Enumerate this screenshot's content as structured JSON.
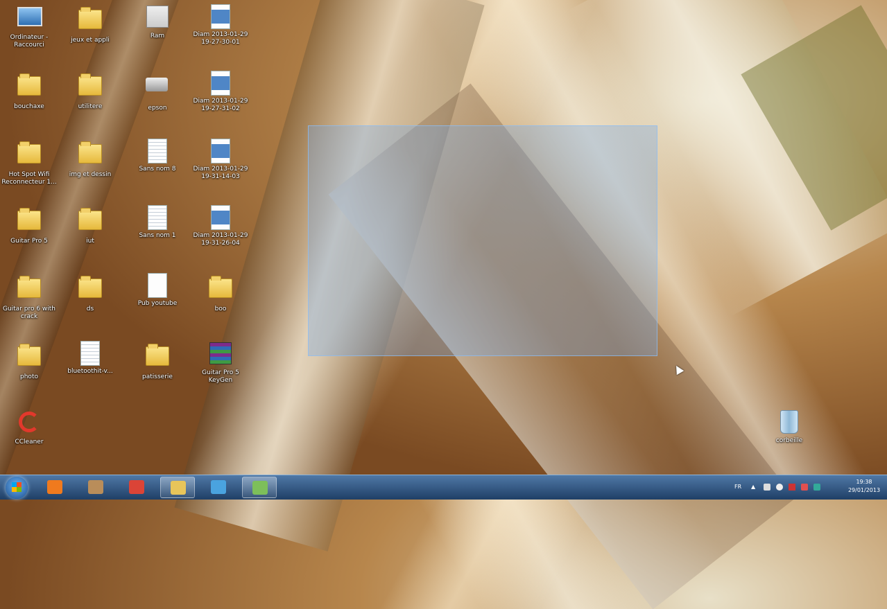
{
  "desktop_icons": [
    {
      "label": "Ordinateur - Raccourci",
      "type": "computer"
    },
    {
      "label": "jeux et appli",
      "type": "folder"
    },
    {
      "label": "Ram",
      "type": "app"
    },
    {
      "label": "Diam 2013-01-29 19-27-30-01",
      "type": "image"
    },
    {
      "label": "bouchaxe",
      "type": "folder"
    },
    {
      "label": "utilitere",
      "type": "folder"
    },
    {
      "label": "epson",
      "type": "printer"
    },
    {
      "label": "Diam 2013-01-29 19-27-31-02",
      "type": "image"
    },
    {
      "label": "Hot Spot Wifi Reconnecteur 1...",
      "type": "folder"
    },
    {
      "label": "img et dessin",
      "type": "folder"
    },
    {
      "label": "Sans nom 8",
      "type": "doc"
    },
    {
      "label": "Diam 2013-01-29 19-31-14-03",
      "type": "image"
    },
    {
      "label": "Guitar Pro 5",
      "type": "folder"
    },
    {
      "label": "iut",
      "type": "folder"
    },
    {
      "label": "Sans nom 1",
      "type": "doc"
    },
    {
      "label": "Diam 2013-01-29 19-31-26-04",
      "type": "image"
    },
    {
      "label": "Guitar pro 6 with crack",
      "type": "folder"
    },
    {
      "label": "ds",
      "type": "folder"
    },
    {
      "label": "Pub youtube",
      "type": "blank"
    },
    {
      "label": "boo",
      "type": "folder"
    },
    {
      "label": "photo",
      "type": "folder"
    },
    {
      "label": "bluetoothit-v...",
      "type": "doc"
    },
    {
      "label": "patisserie",
      "type": "folder"
    },
    {
      "label": "Guitar Pro 5 KeyGen",
      "type": "rar"
    },
    {
      "label": "CCleaner",
      "type": "ccleaner"
    },
    {
      "label": "corbeille",
      "type": "bin"
    }
  ],
  "taskbar": {
    "pinned": [
      {
        "name": "media-player-icon",
        "color": "#f07a1e"
      },
      {
        "name": "tools-icon",
        "color": "#b98d5a"
      },
      {
        "name": "chrome-icon",
        "color": "#db4437"
      },
      {
        "name": "explorer-icon",
        "color": "#e8c55a"
      },
      {
        "name": "paint-icon",
        "color": "#4aa3df"
      },
      {
        "name": "monitor-icon",
        "color": "#7dbf5a"
      }
    ],
    "tray": {
      "language": "FR",
      "time": "19:38",
      "date": "29/01/2013"
    }
  }
}
